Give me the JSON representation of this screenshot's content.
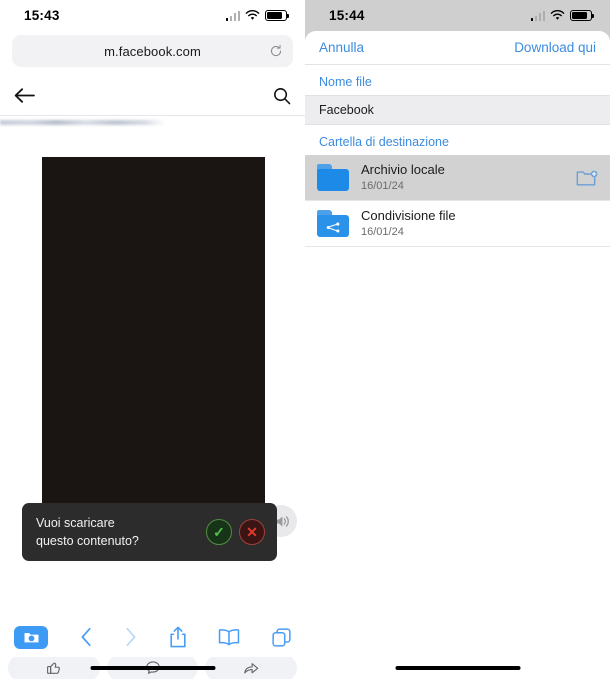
{
  "left_phone": {
    "status_bar": {
      "time": "15:43",
      "signal_icon": "cellular-signal-icon",
      "wifi_icon": "wifi-icon",
      "battery_icon": "battery-icon"
    },
    "browser": {
      "url": "m.facebook.com",
      "reload_icon": "reload-icon",
      "back_icon": "back-arrow-icon",
      "search_icon": "search-icon"
    },
    "page": {
      "blurred_text_placeholder": "",
      "video_placeholder": "",
      "mute_icon": "speaker-mute-icon"
    },
    "download_dialog": {
      "line1": "Vuoi scaricare",
      "line2": "questo contenuto?",
      "confirm_icon": "check-circle-icon",
      "cancel_icon": "x-circle-icon"
    },
    "post_actions": [
      {
        "name": "like",
        "icon": "thumbs-up-icon"
      },
      {
        "name": "comment",
        "icon": "comment-bubble-icon"
      },
      {
        "name": "share",
        "icon": "share-arrow-icon"
      }
    ],
    "safari_toolbar": [
      {
        "name": "downloads",
        "icon": "downloads-folder-icon"
      },
      {
        "name": "back",
        "icon": "chevron-left-icon"
      },
      {
        "name": "forward",
        "icon": "chevron-right-icon"
      },
      {
        "name": "share",
        "icon": "share-up-icon"
      },
      {
        "name": "bookmarks",
        "icon": "book-icon"
      },
      {
        "name": "tabs",
        "icon": "tabs-icon"
      }
    ]
  },
  "right_phone": {
    "status_bar": {
      "time": "15:44",
      "signal_icon": "cellular-signal-icon",
      "wifi_icon": "wifi-icon",
      "battery_icon": "battery-icon"
    },
    "sheet": {
      "cancel_label": "Annulla",
      "confirm_label": "Download qui",
      "filename_section_label": "Nome file",
      "filename_value": "Facebook",
      "destination_section_label": "Cartella di destinazione",
      "new_folder_icon": "new-folder-icon",
      "folders": [
        {
          "name": "Archivio locale",
          "date": "16/01/24",
          "icon": "folder-icon",
          "selected": true
        },
        {
          "name": "Condivisione file",
          "date": "16/01/24",
          "icon": "shared-folder-icon",
          "selected": false
        }
      ]
    }
  },
  "colors": {
    "accent_blue": "#3c8ce0",
    "safari_blue": "#4a9df5",
    "folder_blue": "#1d8ae8",
    "selected_row": "#d2d2d2",
    "dialog_bg": "#2c2c2c",
    "confirm_green": "#53c24a",
    "cancel_red": "#e03b2f"
  }
}
